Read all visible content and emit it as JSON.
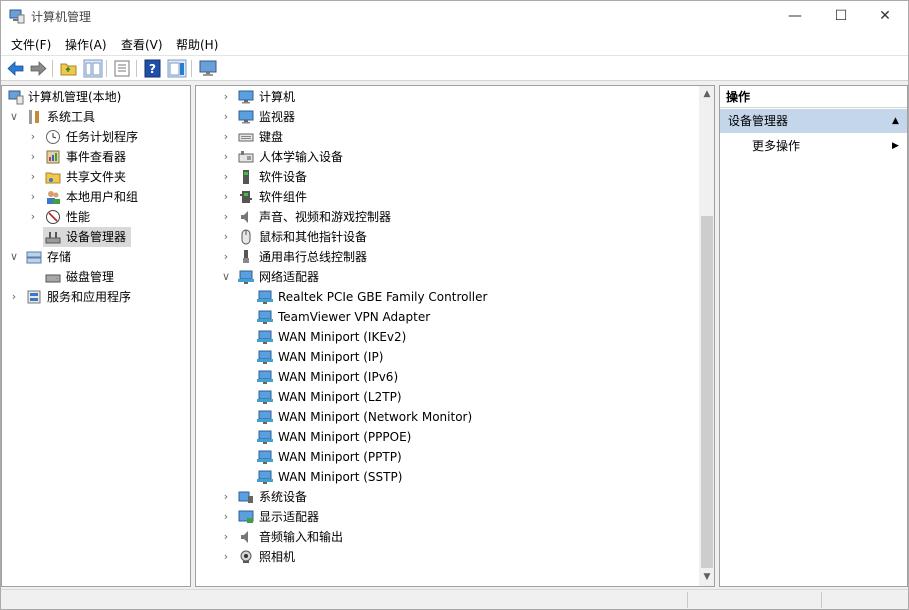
{
  "window": {
    "title": "计算机管理"
  },
  "window_controls": {
    "minimize": "—",
    "maximize": "☐",
    "close": "✕"
  },
  "menu": [
    "文件(F)",
    "操作(A)",
    "查看(V)",
    "帮助(H)"
  ],
  "left_tree": {
    "root": "计算机管理(本地)",
    "system_tools": "系统工具",
    "system_tools_children": [
      "任务计划程序",
      "事件查看器",
      "共享文件夹",
      "本地用户和组",
      "性能",
      "设备管理器"
    ],
    "storage": "存储",
    "storage_children": [
      "磁盘管理"
    ],
    "services": "服务和应用程序",
    "selected": "设备管理器"
  },
  "device_tree": {
    "categories_before": [
      "计算机",
      "监视器",
      "键盘",
      "人体学输入设备",
      "软件设备",
      "软件组件",
      "声音、视频和游戏控制器",
      "鼠标和其他指针设备",
      "通用串行总线控制器"
    ],
    "expanded_category": "网络适配器",
    "network_adapters": [
      "Realtek PCIe GBE Family Controller",
      "TeamViewer VPN Adapter",
      "WAN Miniport (IKEv2)",
      "WAN Miniport (IP)",
      "WAN Miniport (IPv6)",
      "WAN Miniport (L2TP)",
      "WAN Miniport (Network Monitor)",
      "WAN Miniport (PPPOE)",
      "WAN Miniport (PPTP)",
      "WAN Miniport (SSTP)"
    ],
    "categories_after": [
      "系统设备",
      "显示适配器",
      "音频输入和输出",
      "照相机"
    ]
  },
  "actions": {
    "header": "操作",
    "section": "设备管理器",
    "more": "更多操作"
  },
  "icons": {
    "back": "back-arrow-icon",
    "forward": "forward-arrow-icon",
    "folder_up": "folder-up-icon",
    "show_tree": "show-tree-icon",
    "properties": "properties-icon",
    "help": "help-icon",
    "action_pane": "action-pane-icon",
    "monitor": "monitor-icon"
  },
  "colors": {
    "accent": "#1e6fc8",
    "selection": "#d9d9d9",
    "action_header": "#c4d7ea"
  }
}
